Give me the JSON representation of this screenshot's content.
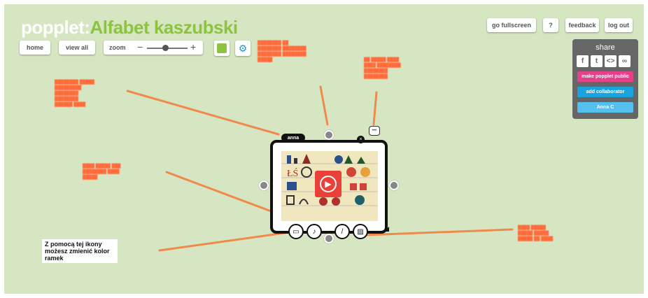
{
  "header": {
    "brand": "popplet:",
    "board_title": "Alfabet kaszubski"
  },
  "toolbar": {
    "home_label": "home",
    "view_all_label": "view all",
    "zoom_label": "zoom",
    "zoom_minus": "−",
    "zoom_plus": "+",
    "zoom_level": 0.45,
    "color_value": "#8cc43f",
    "gear_icon": "gear-icon"
  },
  "top_right": {
    "fullscreen_label": "go fullscreen",
    "help_label": "?",
    "feedback_label": "feedback",
    "logout_label": "log out"
  },
  "share": {
    "title": "share",
    "social": [
      {
        "icon": "facebook-icon",
        "glyph": "f"
      },
      {
        "icon": "twitter-icon",
        "glyph": "t"
      },
      {
        "icon": "embed-icon",
        "glyph": "<>"
      },
      {
        "icon": "link-icon",
        "glyph": "∞"
      }
    ],
    "make_public_label": "make popplet public",
    "add_collaborator_label": "add collaborator",
    "user_label": "Anna C",
    "make_public_color": "#e6408a",
    "add_collaborator_color": "#1aa3dc",
    "user_color": "#55c0ee"
  },
  "popple": {
    "author": "anna",
    "close_glyph": "×",
    "comment_glyph": "•••",
    "play_glyph": "▶",
    "tools": [
      {
        "icon": "frame-color-icon",
        "glyph": "▭"
      },
      {
        "icon": "paint-brush-icon",
        "glyph": "♪"
      },
      {
        "icon": "pen-icon",
        "glyph": "/"
      },
      {
        "icon": "image-icon",
        "glyph": "▨"
      }
    ]
  },
  "hint": {
    "text": "Z pomocą tej ikony możesz zmienić kolor ramek"
  },
  "colors": {
    "canvas_bg": "#d6e6c2",
    "annotation": "#ff6a3a",
    "frame": "#111111"
  }
}
